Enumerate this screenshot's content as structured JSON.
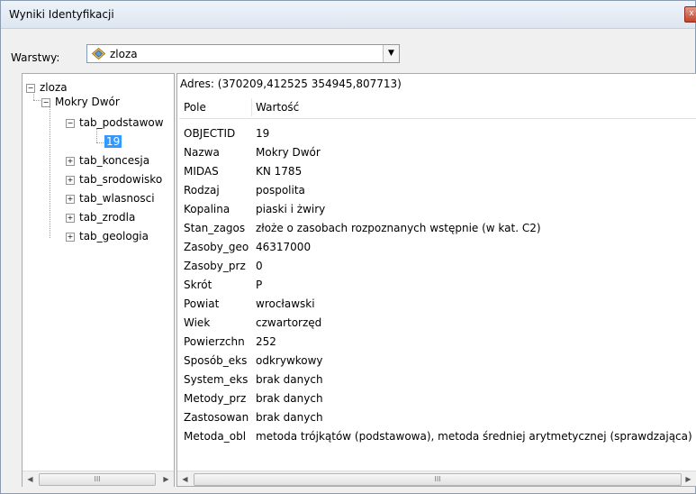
{
  "window": {
    "title": "Wyniki Identyfikacji",
    "close_glyph": "x"
  },
  "layers": {
    "label": "Warstwy:",
    "selected": "zloza",
    "icon": "layer-diamond-icon"
  },
  "tree": {
    "root": "zloza",
    "child": "Mokry Dwór",
    "tables": [
      "tab_podstawow",
      "tab_koncesja",
      "tab_srodowisko",
      "tab_wlasnosci",
      "tab_zrodla",
      "tab_geologia"
    ],
    "selected_record": "19"
  },
  "details": {
    "address": "Adres: (370209,412525 354945,807713)",
    "columns": {
      "field": "Pole",
      "value": "Wartość"
    },
    "rows": [
      {
        "field": "OBJECTID",
        "value": "19"
      },
      {
        "field": "Nazwa",
        "value": "Mokry Dwór"
      },
      {
        "field": "MIDAS",
        "value": "KN 1785"
      },
      {
        "field": "Rodzaj",
        "value": "pospolita"
      },
      {
        "field": "Kopalina",
        "value": "piaski i żwiry"
      },
      {
        "field": "Stan_zagos",
        "value": "złoże o zasobach rozpoznanych wstępnie (w kat. C2)"
      },
      {
        "field": "Zasoby_geo",
        "value": "46317000"
      },
      {
        "field": "Zasoby_prz",
        "value": "0"
      },
      {
        "field": "Skrót",
        "value": "P"
      },
      {
        "field": "Powiat",
        "value": "wrocławski"
      },
      {
        "field": "Wiek",
        "value": "czwartorzęd"
      },
      {
        "field": "Powierzchn",
        "value": "252"
      },
      {
        "field": "Sposób_eks",
        "value": "odkrywkowy"
      },
      {
        "field": "System_eks",
        "value": "brak danych"
      },
      {
        "field": "Metody_prz",
        "value": "brak danych"
      },
      {
        "field": "Zastosowan",
        "value": "brak danych"
      },
      {
        "field": "Metoda_obl",
        "value": "metoda trójkątów (podstawowa), metoda średniej arytmetycznej (sprawdzająca)"
      }
    ]
  },
  "scrollbar": {
    "left_arrow": "◀",
    "right_arrow": "▶",
    "grip": "III"
  }
}
